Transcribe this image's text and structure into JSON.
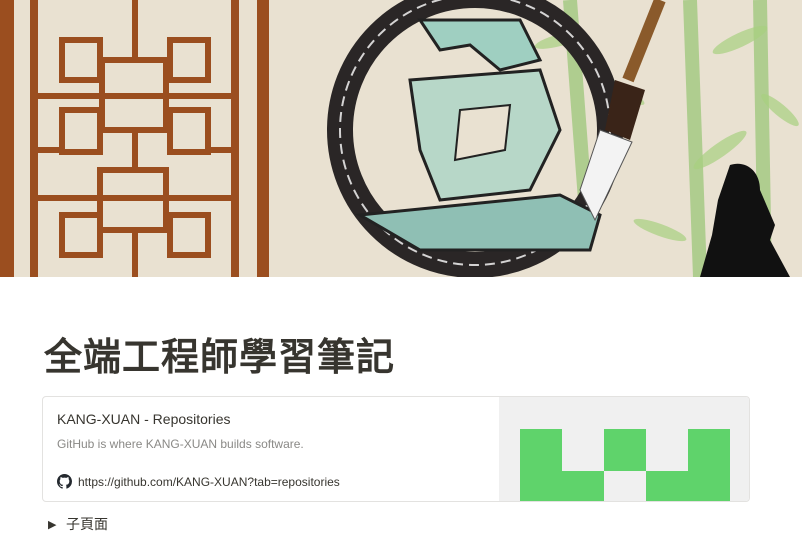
{
  "page": {
    "title": "全端工程師學習筆記"
  },
  "bookmark": {
    "title": "KANG-XUAN - Repositories",
    "description": "GitHub is where KANG-XUAN builds software.",
    "url": "https://github.com/KANG-XUAN?tab=repositories",
    "link_icon": "github-icon",
    "thumbnail_color": "#5fd36b"
  },
  "toggle": {
    "label": "子頁面",
    "icon": "triangle-right-icon"
  },
  "cover": {
    "wood_color": "#9b4e1f",
    "background_color": "#e8dfcf",
    "ring_color": "#2a2626",
    "bamboo_color": "#8ec36a"
  }
}
